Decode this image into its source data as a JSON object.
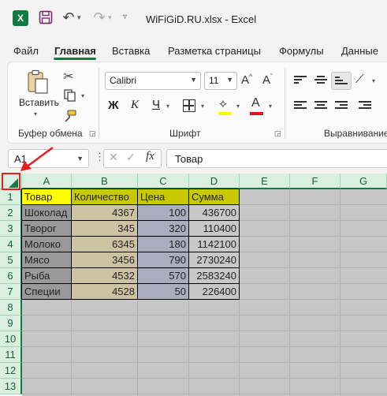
{
  "titlebar": {
    "app_logo": "X",
    "save_icon": "save-icon",
    "undo_icon": "undo-icon",
    "redo_icon": "redo-icon",
    "document_title": "WiFiGiD.RU.xlsx  -  Excel"
  },
  "ribbon_tabs": [
    "Файл",
    "Главная",
    "Вставка",
    "Разметка страницы",
    "Формулы",
    "Данные"
  ],
  "active_tab": "Главная",
  "ribbon": {
    "clipboard": {
      "paste_label": "Вставить",
      "group_label": "Буфер обмена"
    },
    "font": {
      "font_name": "Calibri",
      "font_size": "11",
      "bold": "Ж",
      "italic": "К",
      "underline": "Ч",
      "font_color_letter": "A",
      "group_label": "Шрифт",
      "fill_color": "#ffff00",
      "font_color": "#e81123"
    },
    "alignment": {
      "group_label": "Выравнивание"
    }
  },
  "formula_bar": {
    "name_box": "A1",
    "fx": "fx",
    "content": "Товар"
  },
  "sheet": {
    "columns": [
      "A",
      "B",
      "C",
      "D",
      "E",
      "F",
      "G"
    ],
    "rows": [
      "1",
      "2",
      "3",
      "4",
      "5",
      "6",
      "7",
      "8",
      "9",
      "10",
      "11",
      "12",
      "13"
    ],
    "table": {
      "headers": [
        "Товар",
        "Количество",
        "Цена",
        "Сумма"
      ],
      "data": [
        [
          "Шоколад",
          "4367",
          "100",
          "436700"
        ],
        [
          "Творог",
          "345",
          "320",
          "110400"
        ],
        [
          "Молоко",
          "6345",
          "180",
          "1142100"
        ],
        [
          "Мясо",
          "3456",
          "790",
          "2730240"
        ],
        [
          "Рыба",
          "4532",
          "570",
          "2583240"
        ],
        [
          "Специи",
          "4528",
          "50",
          "226400"
        ]
      ]
    },
    "colors": {
      "header_fill": "#c9c900",
      "header_text_fill": "#ffff00",
      "col_a_fill": "#999999",
      "col_b_fill": "#cdc3a2",
      "col_c_fill": "#a8aebd",
      "col_d_fill": "#c8c8c8",
      "selection_fill": "#c6c6c6",
      "header_accent": "#107c41",
      "annotation": "#e81d1d"
    }
  }
}
